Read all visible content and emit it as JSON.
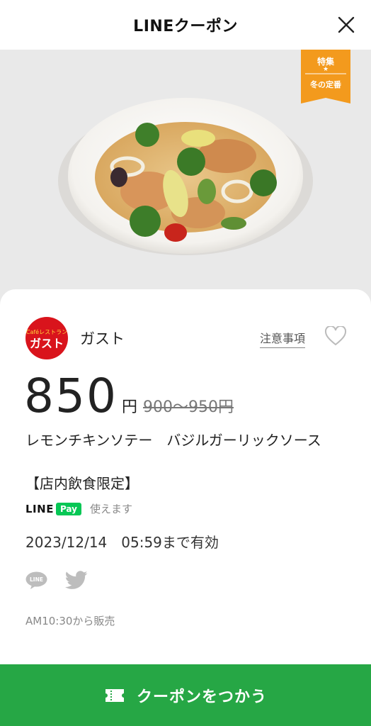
{
  "header": {
    "title": "LINEクーポン"
  },
  "badge": {
    "top": "特集",
    "star": "★",
    "bottom": "冬の定番"
  },
  "store": {
    "name": "ガスト",
    "logo_top": "Caféレストラン",
    "logo_main": "ガスト"
  },
  "notice": {
    "label": "注意事項"
  },
  "price": {
    "value": "850",
    "unit": "円",
    "original": "900〜950円"
  },
  "item": {
    "name": "レモンチキンソテー　バジルガーリックソース",
    "note": "【店内飲食限定】"
  },
  "linepay": {
    "line": "LINE",
    "pay": "Pay",
    "usable": "使えます"
  },
  "expiry": "2023/12/14　05:59まで有効",
  "sale_time": "AM10:30から販売",
  "use_button": {
    "label": "クーポンをつかう"
  },
  "colors": {
    "accent_green": "#26a745",
    "badge_orange": "#f39a1d",
    "linepay_green": "#06c755",
    "logo_red": "#d9141c"
  },
  "icons": [
    "close-icon",
    "heart-icon",
    "line-share-icon",
    "twitter-share-icon",
    "ticket-icon"
  ]
}
